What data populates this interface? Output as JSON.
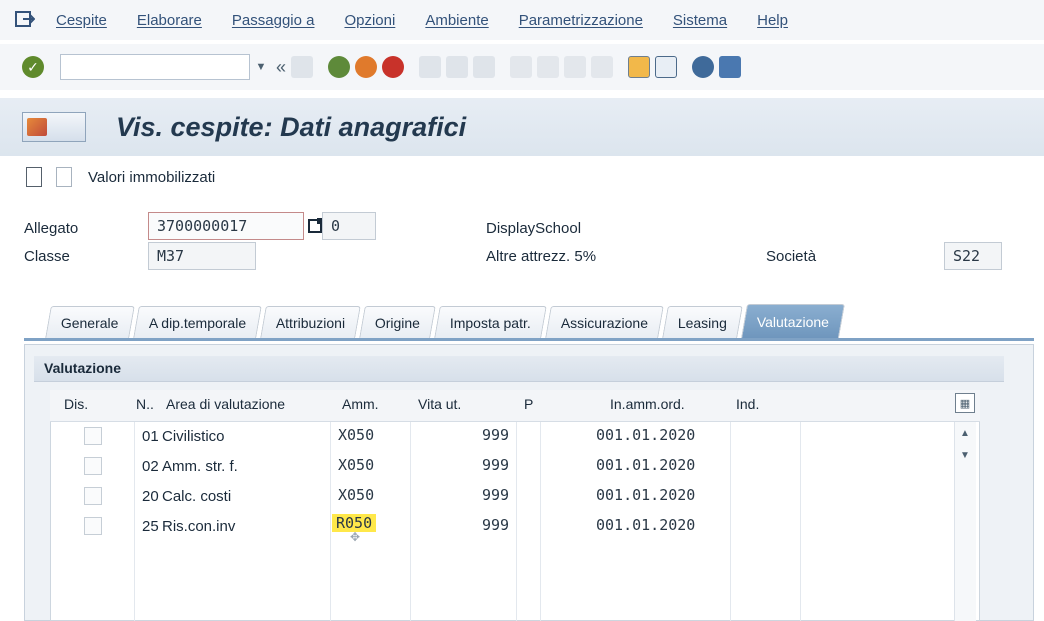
{
  "menu": {
    "items": [
      "Cespite",
      "Elaborare",
      "Passaggio a",
      "Opzioni",
      "Ambiente",
      "Parametrizzazione",
      "Sistema",
      "Help"
    ]
  },
  "toolbar": {
    "back_label": "«"
  },
  "title": "Vis. cespite: Dati anagrafici",
  "app_toolbar": {
    "button_label": "Valori immobilizzati"
  },
  "header": {
    "allegato_label": "Allegato",
    "allegato_value": "3700000017",
    "allegato_sub_value": "0",
    "classe_label": "Classe",
    "classe_value": "M37",
    "display_text": "DisplaySchool",
    "classe_desc": "Altre attrezz. 5%",
    "societa_label": "Società",
    "societa_value": "S22"
  },
  "tabs": [
    "Generale",
    "A dip.temporale",
    "Attribuzioni",
    "Origine",
    "Imposta patr.",
    "Assicurazione",
    "Leasing",
    "Valutazione"
  ],
  "active_tab": "Valutazione",
  "valuation": {
    "section_title": "Valutazione",
    "columns": [
      "Dis.",
      "N..",
      "Area di valutazione",
      "Amm.",
      "Vita ut.",
      "P",
      "In.amm.ord.",
      "Ind."
    ],
    "rows": [
      {
        "num": "01",
        "area": "Civilistico",
        "amm": "X050",
        "vita": "999",
        "inizio": "001.01.2020"
      },
      {
        "num": "02",
        "area": "Amm. str. f.",
        "amm": "X050",
        "vita": "999",
        "inizio": "001.01.2020"
      },
      {
        "num": "20",
        "area": "Calc. costi",
        "amm": "X050",
        "vita": "999",
        "inizio": "001.01.2020"
      },
      {
        "num": "25",
        "area": "Ris.con.inv",
        "amm": "R050",
        "vita": "999",
        "inizio": "001.01.2020"
      }
    ],
    "highlight_color": "#ffe84a"
  },
  "colors": {
    "active_tab": "#7fa2c5",
    "title_text": "#23394f",
    "menu_text": "#33527a"
  }
}
